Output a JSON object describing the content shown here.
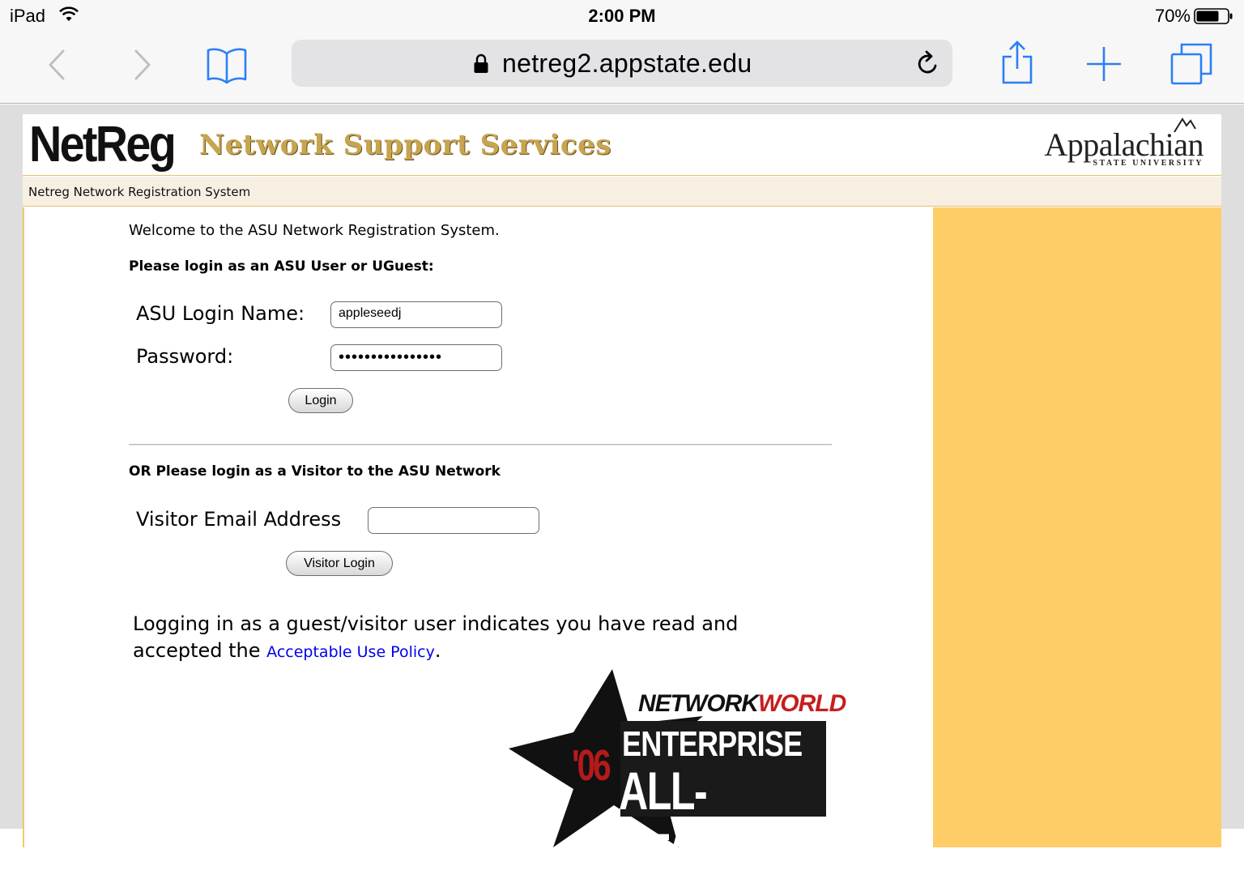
{
  "status_bar": {
    "device": "iPad",
    "time": "2:00 PM",
    "battery": "70%"
  },
  "browser": {
    "url": "netreg2.appstate.edu",
    "icons": [
      "back-icon",
      "forward-icon",
      "bookmarks-icon",
      "lock-icon",
      "reload-icon",
      "share-icon",
      "new-tab-icon",
      "tabs-icon"
    ]
  },
  "header": {
    "logo_netreg": "NetReg",
    "logo_services": "Network Support Services",
    "logo_university": "Appalachian",
    "logo_university_sub": "STATE UNIVERSITY"
  },
  "subbar": {
    "title": "Netreg Network Registration System"
  },
  "login": {
    "welcome": "Welcome to the ASU Network Registration System.",
    "heading": "Please login as an ASU User or UGuest:",
    "login_name_label": "ASU Login Name:",
    "login_name_value": "appleseedj",
    "password_label": "Password:",
    "password_value": "••••••••••••••••",
    "login_button": "Login"
  },
  "visitor": {
    "heading": "OR Please login as a Visitor to the ASU Network",
    "email_label": "Visitor Email Address",
    "email_value": "",
    "login_button": "Visitor Login"
  },
  "policy": {
    "text_before": "Logging in as a guest/visitor user indicates you have read and accepted the",
    "link": "Acceptable Use Policy",
    "text_after": "."
  },
  "award": {
    "brand_1": "NETWORK",
    "brand_2": "WORLD",
    "year": "'06",
    "line1": "ENTERPRISE",
    "line2": "ALL-STAR"
  },
  "colors": {
    "sidebar": "#fecd68",
    "subbar": "#f8efe3",
    "accent_gold": "#c7a54f",
    "ios_blue": "#2a7ff6",
    "link": "#0000ee"
  }
}
